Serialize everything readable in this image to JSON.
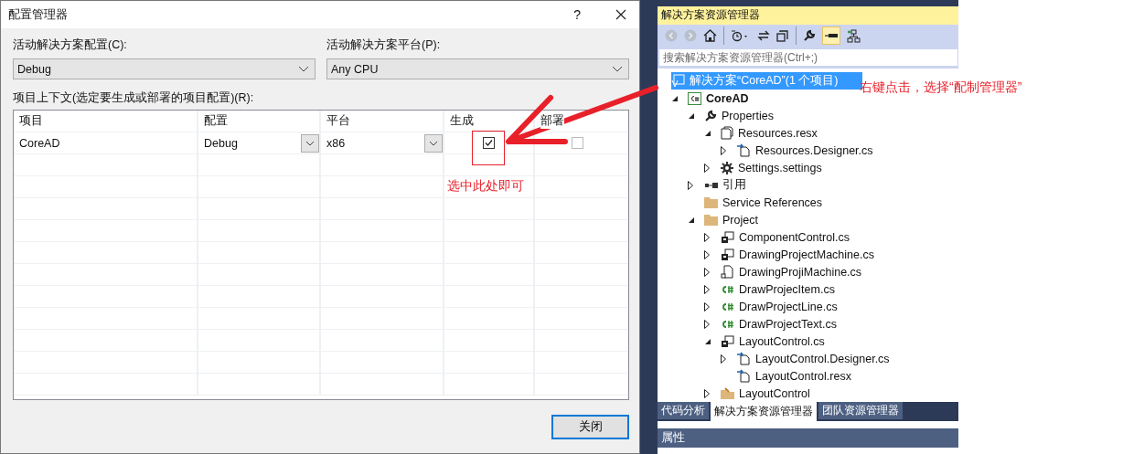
{
  "dialog": {
    "title": "配置管理器",
    "help": "?",
    "config_label": "活动解决方案配置(C):",
    "config_value": "Debug",
    "platform_label": "活动解决方案平台(P):",
    "platform_value": "Any CPU",
    "grid_label": "项目上下文(选定要生成或部署的项目配置)(R):",
    "columns": [
      "项目",
      "配置",
      "平台",
      "生成",
      "部署"
    ],
    "rows": [
      {
        "project": "CoreAD",
        "config": "Debug",
        "platform": "x86",
        "build": true,
        "deploy": false
      }
    ],
    "close_button": "关闭"
  },
  "explorer": {
    "title": "解决方案资源管理器",
    "search": {
      "placeholder": "搜索解决方案资源管理器(Ctrl+;)"
    },
    "tree": [
      {
        "label": "解决方案“CoreAD”(1 个项目)",
        "kind": "solution",
        "selected": true,
        "children": [
          {
            "label": "CoreAD",
            "kind": "project",
            "expanded": true,
            "selected": false,
            "children": [
              {
                "label": "Properties",
                "kind": "wrench",
                "expanded": true,
                "selected": false,
                "children": [
                  {
                    "label": "Resources.resx",
                    "kind": "resx",
                    "expanded": true,
                    "selected": false,
                    "children": [
                      {
                        "label": "Resources.Designer.cs",
                        "kind": "designer",
                        "expanded": false,
                        "selected": false
                      }
                    ]
                  },
                  {
                    "label": "Settings.settings",
                    "kind": "gear",
                    "expanded": false,
                    "selected": false
                  }
                ]
              },
              {
                "label": "引用",
                "kind": "references",
                "expanded": false,
                "selected": false
              },
              {
                "label": "Service References",
                "kind": "folder",
                "selected": false
              },
              {
                "label": "Project",
                "kind": "folder",
                "expanded": true,
                "selected": false,
                "children": [
                  {
                    "label": "ComponentControl.cs",
                    "kind": "form",
                    "expanded": false,
                    "selected": false
                  },
                  {
                    "label": "DrawingProjectMachine.cs",
                    "kind": "form",
                    "expanded": false,
                    "selected": false
                  },
                  {
                    "label": "DrawingProjiMachine.cs",
                    "kind": "file",
                    "expanded": false,
                    "selected": false
                  },
                  {
                    "label": "DrawProjecItem.cs",
                    "kind": "csharp",
                    "expanded": false,
                    "selected": false
                  },
                  {
                    "label": "DrawProjectLine.cs",
                    "kind": "csharp",
                    "expanded": false,
                    "selected": false
                  },
                  {
                    "label": "DrawProjectText.cs",
                    "kind": "csharp",
                    "expanded": false,
                    "selected": false
                  },
                  {
                    "label": "LayoutControl.cs",
                    "kind": "form",
                    "expanded": true,
                    "selected": false,
                    "children": [
                      {
                        "label": "LayoutControl.Designer.cs",
                        "kind": "designer",
                        "expanded": false,
                        "selected": false
                      },
                      {
                        "label": "LayoutControl.resx",
                        "kind": "designer",
                        "selected": false
                      }
                    ]
                  },
                  {
                    "label": "LayoutControl",
                    "kind": "resfolder",
                    "expanded": false,
                    "selected": false
                  }
                ]
              }
            ]
          }
        ]
      }
    ],
    "tabs": [
      {
        "label": "代码分析",
        "selected": false
      },
      {
        "label": "解决方案资源管理器",
        "selected": true
      },
      {
        "label": "团队资源管理器",
        "selected": false
      }
    ],
    "properties_title": "属性"
  },
  "annotations": {
    "check_note": "选中此处即可",
    "right_click_note": "右键点击，选择“配制管理器”"
  }
}
